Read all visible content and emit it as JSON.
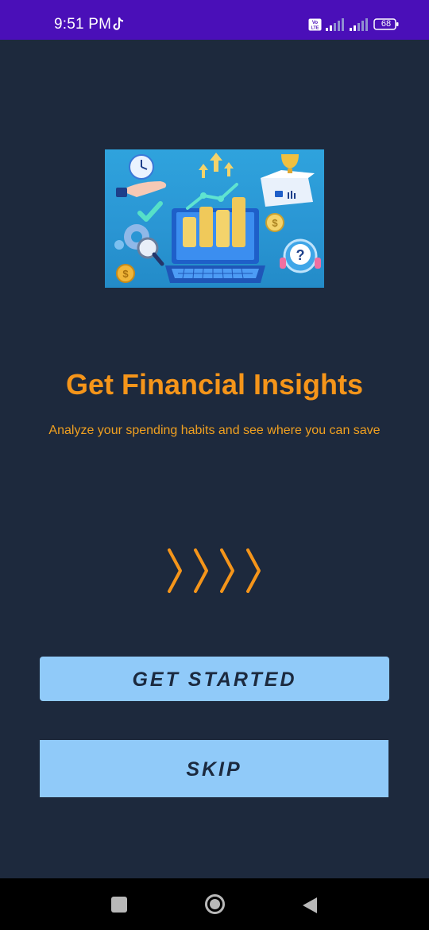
{
  "status_bar": {
    "time": "9:51 PM",
    "battery": "68",
    "icons": [
      "tiktok-icon",
      "volte-icon",
      "signal-icon",
      "signal-icon",
      "battery-icon"
    ],
    "background": "#4a0fb8"
  },
  "onboarding": {
    "title": "Get Financial Insights",
    "subtitle": "Analyze your spending habits and see where you can save",
    "illustration": "financial-insights-illustration",
    "pager_icon": "chevrons-icon"
  },
  "actions": {
    "get_started_label": "GET STARTED",
    "skip_label": "SKIP"
  },
  "nav_bar": {
    "icons": [
      "recents-icon",
      "home-icon",
      "back-icon"
    ]
  },
  "colors": {
    "background": "#1d293d",
    "accent": "#f5951a",
    "button": "#90caf9",
    "button_text": "#1c2a3f"
  }
}
